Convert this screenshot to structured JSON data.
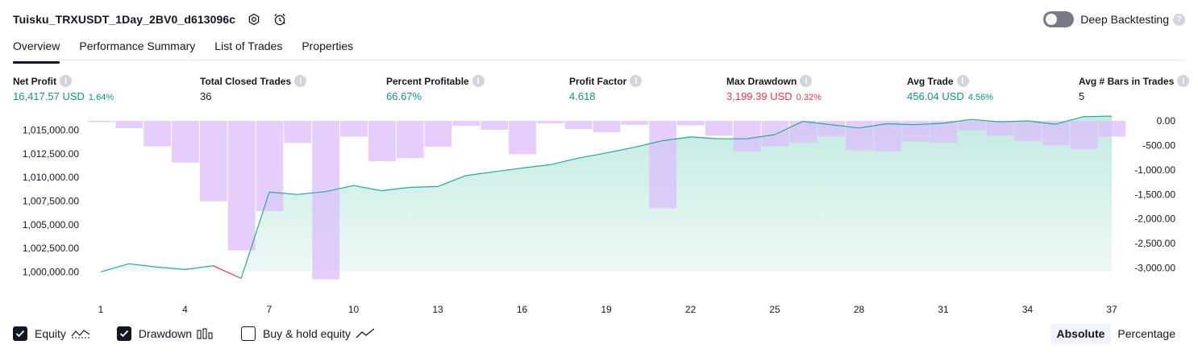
{
  "header": {
    "title": "Tuisku_TRXUSDT_1Day_2BV0_d613096c",
    "deep_backtesting_label": "Deep Backtesting"
  },
  "tabs": [
    {
      "label": "Overview"
    },
    {
      "label": "Performance Summary"
    },
    {
      "label": "List of Trades"
    },
    {
      "label": "Properties"
    }
  ],
  "metrics": {
    "net_profit": {
      "label": "Net Profit",
      "value": "16,417.57 USD",
      "sub": "1.64%"
    },
    "total_closed_trades": {
      "label": "Total Closed Trades",
      "value": "36"
    },
    "percent_profitable": {
      "label": "Percent Profitable",
      "value": "66.67%"
    },
    "profit_factor": {
      "label": "Profit Factor",
      "value": "4.618"
    },
    "max_drawdown": {
      "label": "Max Drawdown",
      "value": "3,199.39 USD",
      "sub": "0.32%"
    },
    "avg_trade": {
      "label": "Avg Trade",
      "value": "456.04 USD",
      "sub": "4.56%"
    },
    "avg_bars": {
      "label": "Avg # Bars in Trades",
      "value": "5"
    }
  },
  "colors": {
    "equity_line": "#22ab94",
    "equity_loss_line": "#f23645",
    "equity_fill": "#b9e6dc",
    "drawdown_bar": "#dcbdfb",
    "drawdown_overlap": "#b0b4e6"
  },
  "chart_data": {
    "type": "area",
    "x": [
      1,
      2,
      3,
      4,
      5,
      6,
      7,
      8,
      9,
      10,
      11,
      12,
      13,
      14,
      15,
      16,
      17,
      18,
      19,
      20,
      21,
      22,
      23,
      24,
      25,
      26,
      27,
      28,
      29,
      30,
      31,
      32,
      33,
      34,
      35,
      36,
      37
    ],
    "x_ticks": [
      "1",
      "4",
      "7",
      "10",
      "13",
      "16",
      "19",
      "22",
      "25",
      "28",
      "31",
      "34",
      "37"
    ],
    "y_left_ticks": [
      "1,015,000.00",
      "1,012,500.00",
      "1,010,000.00",
      "1,007,500.00",
      "1,005,000.00",
      "1,002,500.00",
      "1,000,000.00"
    ],
    "y_right_ticks": [
      "0.00",
      "-500.00",
      "-1,000.00",
      "-1,500.00",
      "-2,000.00",
      "-2,500.00",
      "-3,000.00"
    ],
    "y_left_range": [
      999000,
      1016000
    ],
    "y_right_range": [
      -3270,
      0
    ],
    "series": [
      {
        "name": "Equity",
        "axis": "left",
        "values": [
          1000000,
          1000850,
          1000500,
          1000250,
          1000650,
          999300,
          1008450,
          1008200,
          1008500,
          1009150,
          1008600,
          1008950,
          1009050,
          1010200,
          1010600,
          1011000,
          1011350,
          1012050,
          1012600,
          1013200,
          1013900,
          1014300,
          1014100,
          1014100,
          1014550,
          1015950,
          1015600,
          1015250,
          1015700,
          1015600,
          1015750,
          1016150,
          1015900,
          1016000,
          1015650,
          1016450,
          1016500
        ]
      },
      {
        "name": "Drawdown",
        "axis": "right",
        "values": [
          -25,
          -150,
          -520,
          -850,
          -1640,
          -2640,
          -1840,
          -450,
          -3230,
          -320,
          -820,
          -760,
          -530,
          -100,
          -180,
          -680,
          -50,
          -170,
          -230,
          -80,
          -1780,
          -90,
          -300,
          -620,
          -520,
          -440,
          -310,
          -600,
          -620,
          -420,
          -450,
          -190,
          -300,
          -410,
          -500,
          -570,
          -320
        ]
      }
    ],
    "legend": [
      "Equity",
      "Drawdown",
      "Buy & hold equity"
    ],
    "grid": false
  },
  "footer": {
    "equity_label": "Equity",
    "drawdown_label": "Drawdown",
    "buyhold_label": "Buy & hold equity",
    "absolute_label": "Absolute",
    "percentage_label": "Percentage"
  }
}
